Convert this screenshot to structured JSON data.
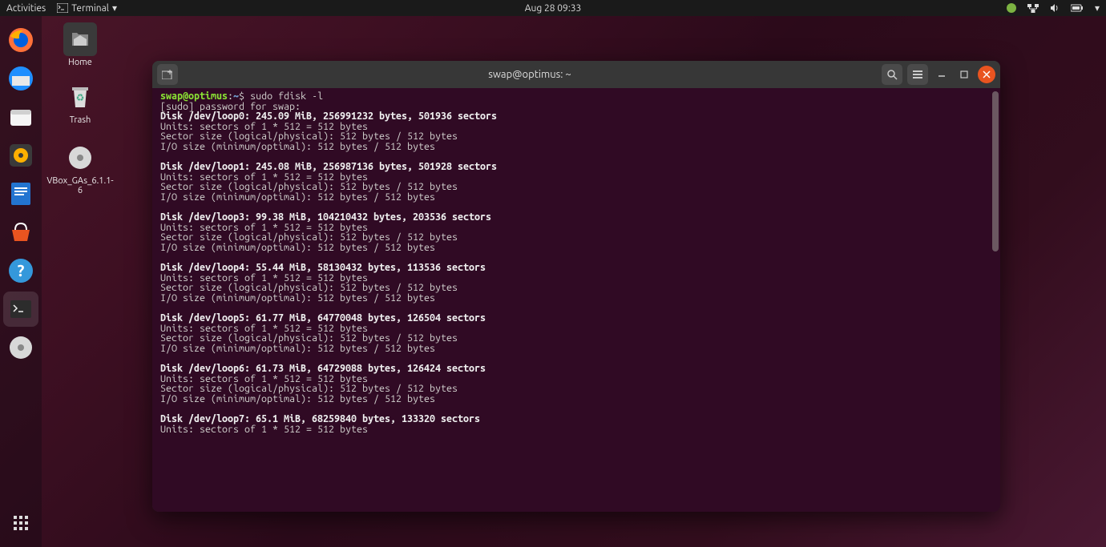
{
  "topbar": {
    "activities": "Activities",
    "app_label": "Terminal",
    "clock": "Aug 28  09:33"
  },
  "desktop": {
    "home": "Home",
    "trash": "Trash",
    "vbox": "VBox_GAs_6.1.1-6"
  },
  "terminal": {
    "title": "swap@optimus: ~",
    "prompt_user": "swap@optimus",
    "prompt_sep": ":",
    "prompt_path": "~",
    "prompt_sym": "$ ",
    "command": "sudo fdisk -l",
    "sudo_line": "[sudo] password for swap:",
    "disks": [
      {
        "head": "Disk /dev/loop0: 245.09 MiB, 256991232 bytes, 501936 sectors",
        "units": "Units: sectors of 1 * 512 = 512 bytes",
        "sector": "Sector size (logical/physical): 512 bytes / 512 bytes",
        "io": "I/O size (minimum/optimal): 512 bytes / 512 bytes"
      },
      {
        "head": "Disk /dev/loop1: 245.08 MiB, 256987136 bytes, 501928 sectors",
        "units": "Units: sectors of 1 * 512 = 512 bytes",
        "sector": "Sector size (logical/physical): 512 bytes / 512 bytes",
        "io": "I/O size (minimum/optimal): 512 bytes / 512 bytes"
      },
      {
        "head": "Disk /dev/loop3: 99.38 MiB, 104210432 bytes, 203536 sectors",
        "units": "Units: sectors of 1 * 512 = 512 bytes",
        "sector": "Sector size (logical/physical): 512 bytes / 512 bytes",
        "io": "I/O size (minimum/optimal): 512 bytes / 512 bytes"
      },
      {
        "head": "Disk /dev/loop4: 55.44 MiB, 58130432 bytes, 113536 sectors",
        "units": "Units: sectors of 1 * 512 = 512 bytes",
        "sector": "Sector size (logical/physical): 512 bytes / 512 bytes",
        "io": "I/O size (minimum/optimal): 512 bytes / 512 bytes"
      },
      {
        "head": "Disk /dev/loop5: 61.77 MiB, 64770048 bytes, 126504 sectors",
        "units": "Units: sectors of 1 * 512 = 512 bytes",
        "sector": "Sector size (logical/physical): 512 bytes / 512 bytes",
        "io": "I/O size (minimum/optimal): 512 bytes / 512 bytes"
      },
      {
        "head": "Disk /dev/loop6: 61.73 MiB, 64729088 bytes, 126424 sectors",
        "units": "Units: sectors of 1 * 512 = 512 bytes",
        "sector": "Sector size (logical/physical): 512 bytes / 512 bytes",
        "io": "I/O size (minimum/optimal): 512 bytes / 512 bytes"
      },
      {
        "head": "Disk /dev/loop7: 65.1 MiB, 68259840 bytes, 133320 sectors",
        "units": "Units: sectors of 1 * 512 = 512 bytes",
        "sector": "",
        "io": ""
      }
    ]
  }
}
